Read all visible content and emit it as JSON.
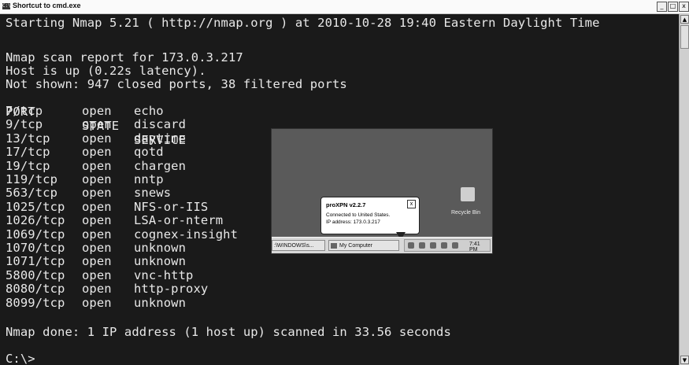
{
  "window": {
    "title": "Shortcut to cmd.exe",
    "icon_label": "C:\\",
    "buttons": {
      "minimize": "_",
      "maximize": "□",
      "close": "x"
    }
  },
  "console": {
    "start_line": "Starting Nmap 5.21 ( http://nmap.org ) at 2010-10-28 19:40 Eastern Daylight Time",
    "report_line": "Nmap scan report for 173.0.3.217",
    "host_line": "Host is up (0.22s latency).",
    "not_shown_line": "Not shown: 947 closed ports, 38 filtered ports",
    "headers": {
      "port": "PORT",
      "state": "STATE",
      "service": "SERVICE"
    },
    "ports": [
      {
        "port": "7/tcp",
        "state": "open",
        "service": "echo"
      },
      {
        "port": "9/tcp",
        "state": "open",
        "service": "discard"
      },
      {
        "port": "13/tcp",
        "state": "open",
        "service": "daytime"
      },
      {
        "port": "17/tcp",
        "state": "open",
        "service": "qotd"
      },
      {
        "port": "19/tcp",
        "state": "open",
        "service": "chargen"
      },
      {
        "port": "119/tcp",
        "state": "open",
        "service": "nntp"
      },
      {
        "port": "563/tcp",
        "state": "open",
        "service": "snews"
      },
      {
        "port": "1025/tcp",
        "state": "open",
        "service": "NFS-or-IIS"
      },
      {
        "port": "1026/tcp",
        "state": "open",
        "service": "LSA-or-nterm"
      },
      {
        "port": "1069/tcp",
        "state": "open",
        "service": "cognex-insight"
      },
      {
        "port": "1070/tcp",
        "state": "open",
        "service": "unknown"
      },
      {
        "port": "1071/tcp",
        "state": "open",
        "service": "unknown"
      },
      {
        "port": "5800/tcp",
        "state": "open",
        "service": "vnc-http"
      },
      {
        "port": "8080/tcp",
        "state": "open",
        "service": "http-proxy"
      },
      {
        "port": "8099/tcp",
        "state": "open",
        "service": "unknown"
      }
    ],
    "done_line": "Nmap done: 1 IP address (1 host up) scanned in 33.56 seconds",
    "prompt": "C:\\>"
  },
  "inset": {
    "recycle_bin_label": "Recycle Bin",
    "balloon": {
      "title": "proXPN v2.2.7",
      "close": "x",
      "line1": "Connected to United States.",
      "line2": "IP address: 173.0.3.217"
    },
    "taskbar": {
      "task_windows": ":\\WINDOWS\\s...",
      "task_my_computer": "My Computer",
      "clock": "7:41 PM"
    }
  }
}
